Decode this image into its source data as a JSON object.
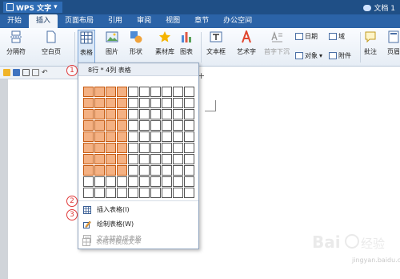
{
  "title_bar": {
    "app_name": "WPS 文字",
    "doc_title": "文档 1"
  },
  "menu_tabs": [
    {
      "label": "开始"
    },
    {
      "label": "插入",
      "active": true
    },
    {
      "label": "页面布局"
    },
    {
      "label": "引用"
    },
    {
      "label": "审阅"
    },
    {
      "label": "视图"
    },
    {
      "label": "章节"
    },
    {
      "label": "办公空间"
    }
  ],
  "ribbon": {
    "page_break": "分隔符",
    "blank_page": "空白页",
    "table": "表格",
    "picture": "图片",
    "shape": "形状",
    "material": "素材库",
    "chart": "图表",
    "textbox": "文本框",
    "wordart": "艺术字",
    "convert": "首字下沉",
    "date": "日期",
    "field": "域",
    "object": "对象",
    "attachment": "附件",
    "comment": "批注",
    "header": "页眉"
  },
  "table_dropdown": {
    "grid_label": "8行 * 4列 表格",
    "rows": 10,
    "cols": 10,
    "selected_rows": 8,
    "selected_cols": 4,
    "items": [
      {
        "label": "插入表格(I)",
        "enabled": true
      },
      {
        "label": "绘制表格(W)",
        "enabled": true
      },
      {
        "label": "文本转换成表格",
        "enabled": false
      },
      {
        "label": "表格转换成文本",
        "enabled": false
      }
    ]
  },
  "markers": [
    "1",
    "2",
    "3"
  ],
  "watermark": {
    "text": "jingyan.baidu.com"
  },
  "colors": {
    "title_bar": "#1f4f86",
    "menu_bar": "#2b63a7",
    "selection": "#f4b183",
    "marker": "#e03a3a"
  }
}
